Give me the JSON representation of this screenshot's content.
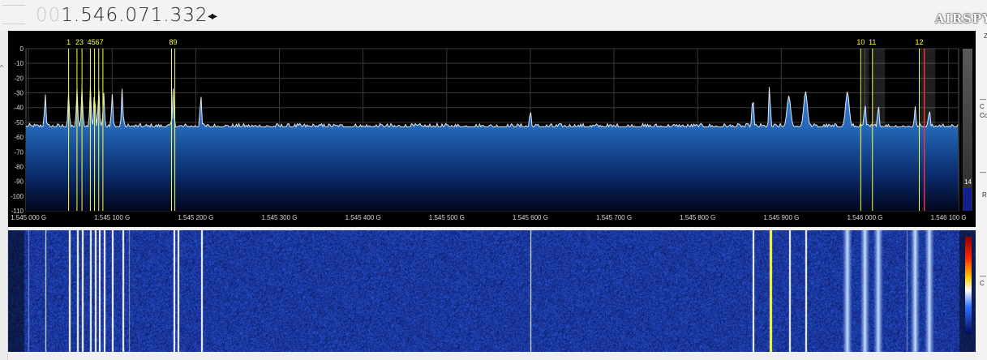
{
  "header": {
    "frequency_lead": "00",
    "frequency_main": "1.546.071.332",
    "frequency_arrows": "◂▸",
    "logo_text": "AIRSPY",
    "left_chevron": "^"
  },
  "right_rail": {
    "labels": [
      "Z",
      "—C",
      "Co",
      "—",
      "R",
      "—C"
    ]
  },
  "spectrum": {
    "y_axis_ticks": [
      "0",
      "-10",
      "-20",
      "-30",
      "-40",
      "-50",
      "-60",
      "-70",
      "-80",
      "-90",
      "-100",
      "-110"
    ],
    "x_axis_ticks": [
      "1.545 000 G",
      "1.545 100 G",
      "1.545 200 G",
      "1.545 300 G",
      "1.545 400 G",
      "1.545 500 G",
      "1.545 600 G",
      "1.545 700 G",
      "1.545 800 G",
      "1.545 900 G",
      "1.546 000 G",
      "1.546 100 G"
    ],
    "marker_labels": [
      "1",
      "23",
      "4567",
      "89",
      "10",
      "11",
      "12"
    ],
    "level_meter_value": "14",
    "colors": {
      "accent": "#ffff33",
      "trace": "#dfe8f5",
      "fill_top": "#2a6fc4",
      "fill_bottom": "#020a2a",
      "cursor": "#ff3333"
    }
  },
  "chart_data": {
    "type": "line",
    "title": "",
    "xlabel": "",
    "ylabel": "",
    "xlim": [
      1.544997,
      1.546112
    ],
    "ylim": [
      -110,
      0
    ],
    "noise_floor_db": -53,
    "peaks": [
      {
        "x": 1.54502,
        "y": -30
      },
      {
        "x": 1.545048,
        "y": -30
      },
      {
        "x": 1.545058,
        "y": -27
      },
      {
        "x": 1.545064,
        "y": -27
      },
      {
        "x": 1.545074,
        "y": -26
      },
      {
        "x": 1.545079,
        "y": -28
      },
      {
        "x": 1.545084,
        "y": -27
      },
      {
        "x": 1.54509,
        "y": -30
      },
      {
        "x": 1.5451,
        "y": -30
      },
      {
        "x": 1.545112,
        "y": -27
      },
      {
        "x": 1.545173,
        "y": -27
      },
      {
        "x": 1.545206,
        "y": -30
      },
      {
        "x": 1.5456,
        "y": -41
      },
      {
        "x": 1.545866,
        "y": -30
      },
      {
        "x": 1.545886,
        "y": -23
      },
      {
        "x": 1.545909,
        "y": -32
      },
      {
        "x": 1.545929,
        "y": -29
      },
      {
        "x": 1.545979,
        "y": -29
      },
      {
        "x": 1.546,
        "y": -36
      },
      {
        "x": 1.546016,
        "y": -37
      },
      {
        "x": 1.54606,
        "y": -39
      },
      {
        "x": 1.546077,
        "y": -40
      }
    ]
  }
}
